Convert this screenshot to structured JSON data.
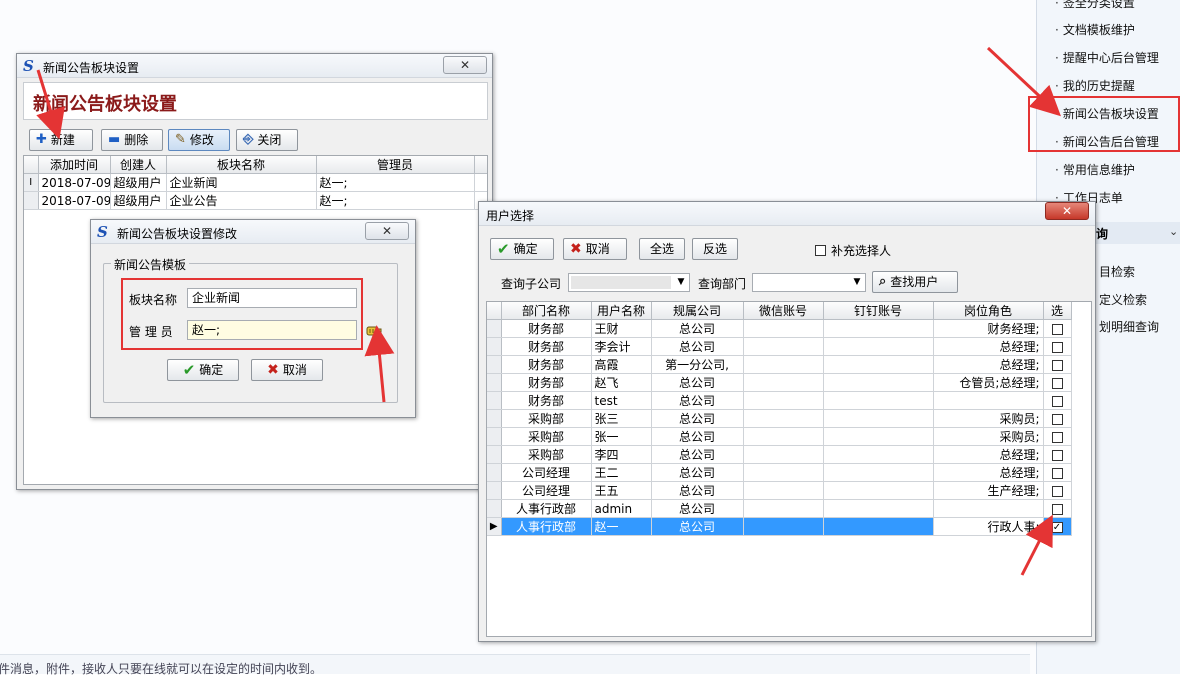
{
  "background": {
    "bottom_text": "件消息，附件，接收人只要在线就可以在设定的时间内收到。"
  },
  "right_nav": {
    "top_items": [
      "签全分类设置",
      "文档模板维护",
      "提醒中心后台管理",
      "我的历史提醒",
      "新闻公告板块设置",
      "新闻公告后台管理",
      "常用信息维护",
      "工作日志单"
    ],
    "section_label": "询",
    "section_chevron": "⌄",
    "sub_items": [
      "目检索",
      "定义检索",
      "划明细查询"
    ]
  },
  "module_window": {
    "title": "新闻公告板块设置",
    "header": "新闻公告板块设置",
    "close_label": "✕",
    "toolbar": {
      "new": "新建",
      "delete": "删除",
      "edit": "修改",
      "close": "关闭"
    },
    "columns": [
      "添加时间",
      "创建人",
      "板块名称",
      "管理员"
    ],
    "rows": [
      {
        "indicator": "I",
        "date": "2018-07-09",
        "creator": "超级用户",
        "name": "企业新闻",
        "admin": "赵一;"
      },
      {
        "indicator": "",
        "date": "2018-07-09",
        "creator": "超级用户",
        "name": "企业公告",
        "admin": "赵一;"
      }
    ]
  },
  "edit_dialog": {
    "title": "新闻公告板块设置修改",
    "close_label": "✕",
    "group_label": "新闻公告模板",
    "name_label": "板块名称",
    "name_value": "企业新闻",
    "admin_label": "管 理 员",
    "admin_value": "赵一;",
    "ok": "确定",
    "cancel": "取消"
  },
  "user_dialog": {
    "title": "用户选择",
    "close_label": "✕",
    "toolbar": {
      "ok": "确定",
      "cancel": "取消",
      "select_all": "全选",
      "invert": "反选",
      "supplement": "补充选择人"
    },
    "filter": {
      "company_label": "查询子公司",
      "dept_label": "查询部门",
      "search": "查找用户"
    },
    "columns": [
      "部门名称",
      "用户名称",
      "规属公司",
      "微信账号",
      "钉钉账号",
      "岗位角色",
      "选"
    ],
    "rows": [
      {
        "dept": "财务部",
        "user": "王财",
        "company": "总公司",
        "wechat": "",
        "dingtalk": "",
        "role": "财务经理;",
        "checked": false,
        "selected": false
      },
      {
        "dept": "财务部",
        "user": "李会计",
        "company": "总公司",
        "wechat": "",
        "dingtalk": "",
        "role": "总经理;",
        "checked": false,
        "selected": false
      },
      {
        "dept": "财务部",
        "user": "高霞",
        "company": "第一分公司,",
        "wechat": "",
        "dingtalk": "",
        "role": "总经理;",
        "checked": false,
        "selected": false
      },
      {
        "dept": "财务部",
        "user": "赵飞",
        "company": "总公司",
        "wechat": "",
        "dingtalk": "",
        "role": "仓管员;总经理;",
        "checked": false,
        "selected": false
      },
      {
        "dept": "财务部",
        "user": "test",
        "company": "总公司",
        "wechat": "",
        "dingtalk": "",
        "role": "",
        "checked": false,
        "selected": false
      },
      {
        "dept": "采购部",
        "user": "张三",
        "company": "总公司",
        "wechat": "",
        "dingtalk": "",
        "role": "采购员;",
        "checked": false,
        "selected": false
      },
      {
        "dept": "采购部",
        "user": "张一",
        "company": "总公司",
        "wechat": "",
        "dingtalk": "",
        "role": "采购员;",
        "checked": false,
        "selected": false
      },
      {
        "dept": "采购部",
        "user": "李四",
        "company": "总公司",
        "wechat": "",
        "dingtalk": "",
        "role": "总经理;",
        "checked": false,
        "selected": false
      },
      {
        "dept": "公司经理",
        "user": "王二",
        "company": "总公司",
        "wechat": "",
        "dingtalk": "",
        "role": "总经理;",
        "checked": false,
        "selected": false
      },
      {
        "dept": "公司经理",
        "user": "王五",
        "company": "总公司",
        "wechat": "",
        "dingtalk": "",
        "role": "生产经理;",
        "checked": false,
        "selected": false
      },
      {
        "dept": "人事行政部",
        "user": "admin",
        "company": "总公司",
        "wechat": "",
        "dingtalk": "",
        "role": "",
        "checked": false,
        "selected": false
      },
      {
        "dept": "人事行政部",
        "user": "赵一",
        "company": "总公司",
        "wechat": "",
        "dingtalk": "",
        "role": "行政人事;",
        "checked": true,
        "selected": true
      }
    ]
  },
  "colors": {
    "accent_red": "#e43434",
    "selection": "#3399ff",
    "header_red": "#8b1a1a"
  }
}
